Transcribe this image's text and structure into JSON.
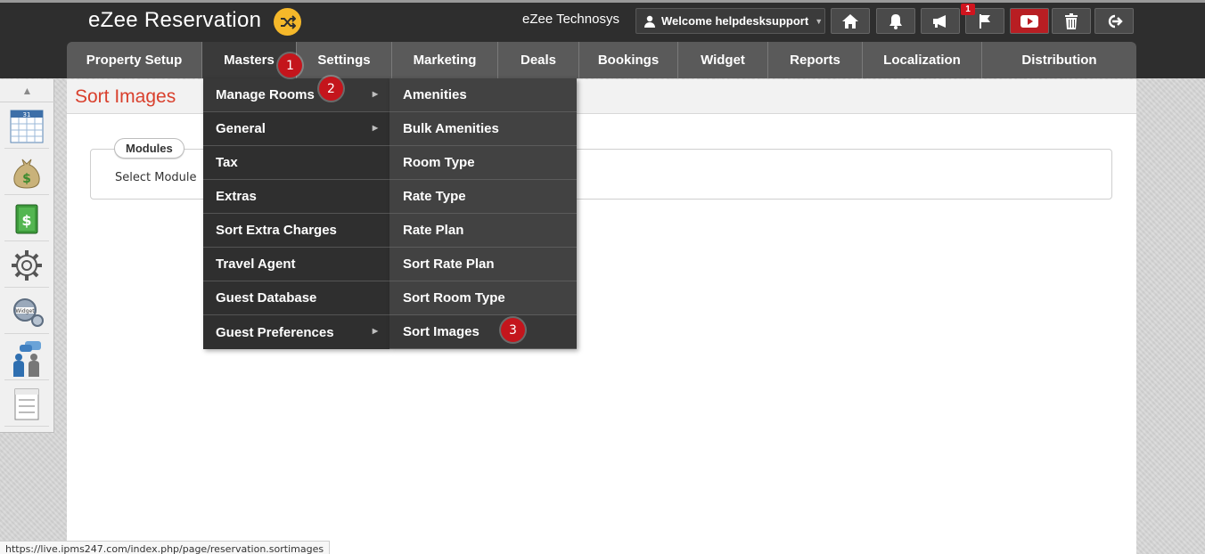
{
  "header": {
    "app_title": "eZee Reservation",
    "company": "eZee Technosys",
    "welcome": "Welcome helpdesksupport",
    "notification_count": "1",
    "icons": [
      "home-icon",
      "bell-icon",
      "megaphone-icon",
      "flag-icon",
      "youtube-icon",
      "trash-icon",
      "logout-icon"
    ]
  },
  "nav": {
    "items": [
      {
        "label": "Property Setup"
      },
      {
        "label": "Masters"
      },
      {
        "label": "Settings"
      },
      {
        "label": "Marketing"
      },
      {
        "label": "Deals"
      },
      {
        "label": "Bookings"
      },
      {
        "label": "Widget"
      },
      {
        "label": "Reports"
      },
      {
        "label": "Localization"
      },
      {
        "label": "Distribution"
      }
    ]
  },
  "masters_menu": {
    "items": [
      {
        "label": "Manage Rooms"
      },
      {
        "label": "General"
      },
      {
        "label": "Tax"
      },
      {
        "label": "Extras"
      },
      {
        "label": "Sort Extra Charges"
      },
      {
        "label": "Travel Agent"
      },
      {
        "label": "Guest Database"
      },
      {
        "label": "Guest Preferences"
      }
    ]
  },
  "manage_rooms_menu": {
    "items": [
      {
        "label": "Amenities"
      },
      {
        "label": "Bulk Amenities"
      },
      {
        "label": "Room Type"
      },
      {
        "label": "Rate Type"
      },
      {
        "label": "Rate Plan"
      },
      {
        "label": "Sort Rate Plan"
      },
      {
        "label": "Sort Room Type"
      },
      {
        "label": "Sort Images"
      }
    ]
  },
  "steps": [
    "1",
    "2",
    "3"
  ],
  "sidebar": {
    "icons": [
      "calendar-icon",
      "money-bag-icon",
      "dollar-note-icon",
      "gear-icon",
      "widget-gear-icon",
      "users-chat-icon",
      "task-list-icon"
    ],
    "calendar_day": "31"
  },
  "page": {
    "title": "Sort Images",
    "modules_label": "Modules",
    "select_module": "Select Module"
  },
  "status_url": "https://live.ipms247.com/index.php/page/reservation.sortimages",
  "colors": {
    "header_bg": "#2e2e2e",
    "nav_bg": "#5a5a5a",
    "accent_red": "#d9402d",
    "step_marker": "#c4151c",
    "shuffle_badge": "#f5b82a"
  }
}
